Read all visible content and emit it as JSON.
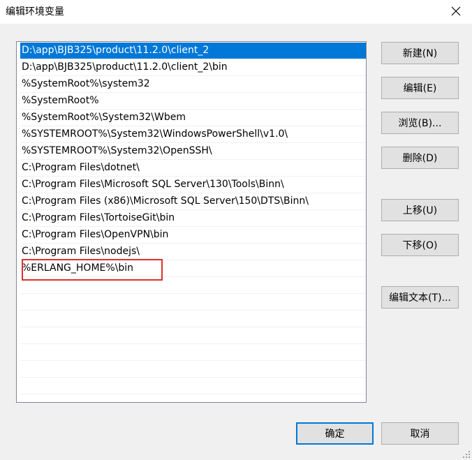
{
  "window": {
    "title": "编辑环境变量"
  },
  "list": {
    "items": [
      "D:\\app\\BJB325\\product\\11.2.0\\client_2",
      "D:\\app\\BJB325\\product\\11.2.0\\client_2\\bin",
      "%SystemRoot%\\system32",
      "%SystemRoot%",
      "%SystemRoot%\\System32\\Wbem",
      "%SYSTEMROOT%\\System32\\WindowsPowerShell\\v1.0\\",
      "%SYSTEMROOT%\\System32\\OpenSSH\\",
      "C:\\Program Files\\dotnet\\",
      "C:\\Program Files\\Microsoft SQL Server\\130\\Tools\\Binn\\",
      "C:\\Program Files (x86)\\Microsoft SQL Server\\150\\DTS\\Binn\\",
      "C:\\Program Files\\TortoiseGit\\bin",
      "C:\\Program Files\\OpenVPN\\bin",
      "C:\\Program Files\\nodejs\\",
      "%ERLANG_HOME%\\bin"
    ]
  },
  "buttons": {
    "new": "新建(N)",
    "edit": "编辑(E)",
    "browse": "浏览(B)...",
    "delete": "删除(D)",
    "move_up": "上移(U)",
    "move_down": "下移(O)",
    "edit_text": "编辑文本(T)...",
    "ok": "确定",
    "cancel": "取消"
  },
  "colors": {
    "selection": "#0078d7",
    "highlight_border": "#e0302b"
  }
}
